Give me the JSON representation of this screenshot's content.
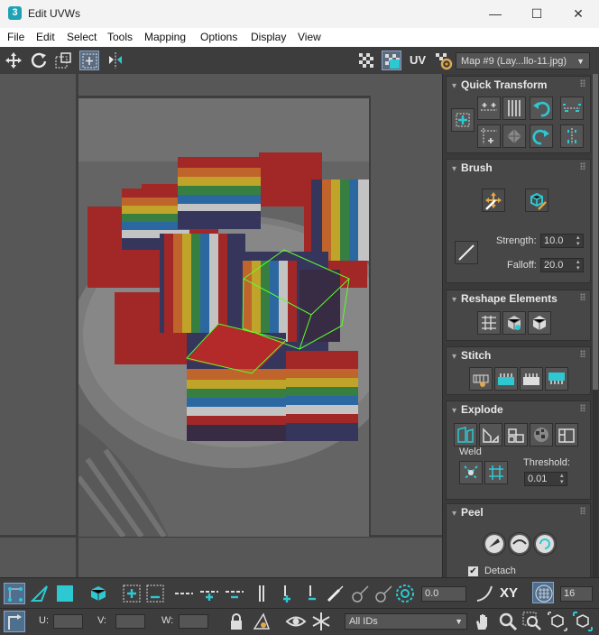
{
  "window": {
    "title": "Edit UVWs",
    "app_icon_label": "3",
    "minimize": "—",
    "maximize": "☐",
    "close": "✕"
  },
  "menu": [
    "File",
    "Edit",
    "Select",
    "Tools",
    "Mapping",
    "Options",
    "Display",
    "View"
  ],
  "toolbar": {
    "uv_label": "UV",
    "map_select": "Map #9 (Lay...llo-11.jpg)"
  },
  "panel": {
    "quick_transform": {
      "title": "Quick Transform"
    },
    "brush": {
      "title": "Brush",
      "strength_label": "Strength:",
      "strength_value": "10.0",
      "falloff_label": "Falloff:",
      "falloff_value": "20.0"
    },
    "reshape": {
      "title": "Reshape Elements"
    },
    "stitch": {
      "title": "Stitch"
    },
    "explode": {
      "title": "Explode",
      "weld_label": "Weld",
      "threshold_label": "Threshold:",
      "threshold_value": "0.01"
    },
    "peel": {
      "title": "Peel",
      "detach_label": "Detach",
      "detach_checked": true
    },
    "accent_color": "#2ec8d2"
  },
  "bottom": {
    "angle_value": "0.0",
    "xy_label": "XY",
    "grid_value": "16",
    "u_label": "U:",
    "v_label": "V:",
    "w_label": "W:",
    "ids_select": "All IDs"
  }
}
